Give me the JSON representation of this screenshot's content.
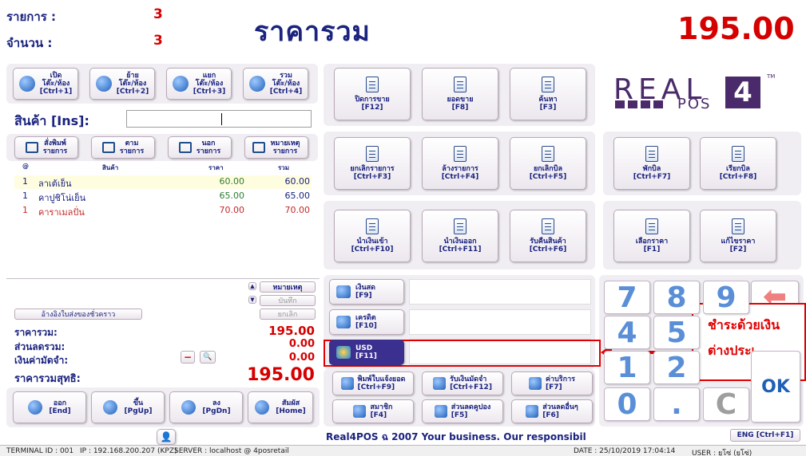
{
  "header": {
    "items_label": "รายการ :",
    "items_value": "3",
    "qty_label": "จำนวน :",
    "qty_value": "3",
    "title": "ราคารวม",
    "total": "195.00"
  },
  "table_buttons": [
    {
      "label": "เปิด\nโต๊ะ/ห้อง\n[Ctrl+1]",
      "icon": "table-open-icon"
    },
    {
      "label": "ย้าย\nโต๊ะ/ห้อง\n[Ctrl+2]",
      "icon": "table-move-icon"
    },
    {
      "label": "แยก\nโต๊ะ/ห้อง\n[Ctrl+3]",
      "icon": "table-split-icon"
    },
    {
      "label": "รวม\nโต๊ะ/ห้อง\n[Ctrl+4]",
      "icon": "table-merge-icon"
    }
  ],
  "product": {
    "label": "สินค้า [Ins]:",
    "value": ""
  },
  "order_buttons": [
    {
      "label": "สั่งพิมพ์\nรายการ",
      "icon": "print-order-icon"
    },
    {
      "label": "ตาม\nรายการ",
      "icon": "follow-order-icon"
    },
    {
      "label": "นอก\nรายการ",
      "icon": "outside-order-icon"
    },
    {
      "label": "หมายเหตุ\nรายการ",
      "icon": "note-order-icon"
    }
  ],
  "table": {
    "headers": {
      "qty": "@",
      "name": "สินค้า",
      "price": "ราคา",
      "total": "รวม"
    },
    "rows": [
      {
        "qty": "1",
        "name": "ลาเต้เย็น",
        "price": "60.00",
        "total": "60.00"
      },
      {
        "qty": "1",
        "name": "คาปูชิโน่เย็น",
        "price": "65.00",
        "total": "65.00"
      },
      {
        "qty": "1",
        "name": "คาราเมลปั่น",
        "price": "70.00",
        "total": "70.00"
      }
    ]
  },
  "side_buttons": {
    "note": "หมายเหตุ",
    "save": "บันทึก",
    "cancel": "ยกเลิก"
  },
  "ref_button": "อ้างอิงใบส่งของชั่วคราว",
  "summary": {
    "total_label": "ราคารวม:",
    "total_value": "195.00",
    "discount_label": "ส่วนลดรวม:",
    "discount_value": "0.00",
    "deposit_label": "เงินค่ามัดจำ:",
    "deposit_value": "0.00",
    "net_label": "ราคารวมสุทธิ:",
    "net_value": "195.00"
  },
  "nav_buttons": [
    {
      "label": "ออก\n[End]",
      "icon": "power-icon"
    },
    {
      "label": "ขึ้น\n[PgUp]",
      "icon": "arrow-up-icon"
    },
    {
      "label": "ลง\n[PgDn]",
      "icon": "arrow-down-icon"
    },
    {
      "label": "สัมผัส\n[Home]",
      "icon": "touch-icon"
    }
  ],
  "func_row1": [
    {
      "label": "ปิดการขาย\n[F12]"
    },
    {
      "label": "ยอดขาย\n[F8]"
    },
    {
      "label": "ค้นหา\n[F3]"
    }
  ],
  "func_row2": [
    {
      "label": "ยกเลิกรายการ\n[Ctrl+F3]"
    },
    {
      "label": "ล้างรายการ\n[Ctrl+F4]"
    },
    {
      "label": "ยกเลิกบิล\n[Ctrl+F5]"
    },
    {
      "label": "พักบิล\n[Ctrl+F7]"
    },
    {
      "label": "เรียกบิล\n[Ctrl+F8]"
    }
  ],
  "func_row3": [
    {
      "label": "นำเงินเข้า\n[Ctrl+F10]"
    },
    {
      "label": "นำเงินออก\n[Ctrl+F11]"
    },
    {
      "label": "รับคืนสินค้า\n[Ctrl+F6]"
    },
    {
      "label": "เลือกราคา\n[F1]"
    },
    {
      "label": "แก้ไขราคา\n[F2]"
    }
  ],
  "payments": [
    {
      "label": "เงินสด\n[F9]"
    },
    {
      "label": "เครดิต\n[F10]"
    },
    {
      "label": "USD\n[F11]"
    }
  ],
  "bottom_buttons": [
    {
      "label": "พิมพ์ใบแจ้งยอด\n[Ctrl+F9]"
    },
    {
      "label": "รับเงินมัดจำ\n[Ctrl+F12]"
    },
    {
      "label": "ค่าบริการ\n[F7]"
    },
    {
      "label": "สมาชิก\n[F4]"
    },
    {
      "label": "ส่วนลดคูปอง\n[F5]"
    },
    {
      "label": "ส่วนลดอื่นๆ\n[F6]"
    }
  ],
  "keypad": [
    "7",
    "8",
    "9",
    "4",
    "5",
    "1",
    "2",
    "0",
    ".",
    "C",
    "OK"
  ],
  "logo": {
    "text1": "REAL",
    "text2": "POS",
    "num": "4",
    "tm": "TM"
  },
  "marquee": "Real4POS ฉ 2007 Your business. Our responsibil",
  "lang_button": "ENG [Ctrl+F1]",
  "callout": "ชำระด้วยเงิน\nต่างประเ",
  "status": {
    "terminal": "TERMINAL ID : 001",
    "ip": "IP : 192.168.200.207 (KPZ)",
    "server": "SERVER : localhost @ 4posretail",
    "date": "DATE : 25/10/2019  17:04:14",
    "user": "USER : ยูโซ่ (ยูโซ่)"
  },
  "colors": {
    "accent_red": "#d50000",
    "navy": "#1a237e",
    "highlight": "#3b2f8f",
    "callout_border": "#e00000"
  }
}
